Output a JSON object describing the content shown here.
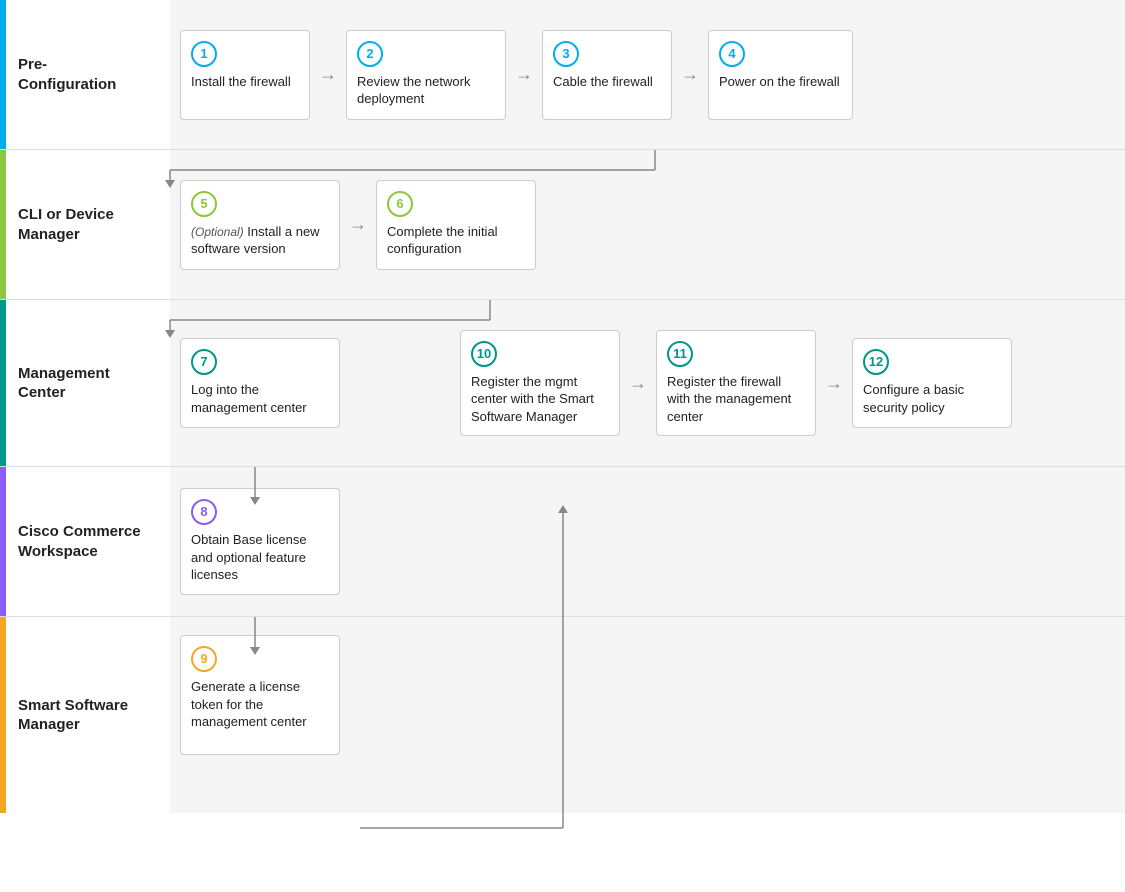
{
  "sections": [
    {
      "id": "pre-config",
      "label": "Pre-\nConfiguration",
      "color": "blue",
      "steps": [
        {
          "num": "1",
          "color": "blue",
          "text": "Install the firewall"
        },
        {
          "num": "2",
          "color": "blue",
          "text": "Review the network deployment"
        },
        {
          "num": "3",
          "color": "blue",
          "text": "Cable the firewall"
        },
        {
          "num": "4",
          "color": "blue",
          "text": "Power on the firewall"
        }
      ]
    },
    {
      "id": "cli",
      "label": "CLI or Device Manager",
      "color": "green",
      "steps": [
        {
          "num": "5",
          "color": "green",
          "text": "Install a new software version",
          "optional": true
        },
        {
          "num": "6",
          "color": "green",
          "text": "Complete the initial configuration"
        }
      ]
    },
    {
      "id": "mgmt",
      "label": "Management Center",
      "color": "teal",
      "steps": [
        {
          "num": "7",
          "color": "teal",
          "text": "Log into the management center"
        },
        {
          "num": "10",
          "color": "teal",
          "text": "Register the mgmt center with the Smart Software Manager"
        },
        {
          "num": "11",
          "color": "teal",
          "text": "Register the firewall with the management center"
        },
        {
          "num": "12",
          "color": "teal",
          "text": "Configure a basic security policy"
        }
      ]
    },
    {
      "id": "cisco",
      "label": "Cisco Commerce Workspace",
      "color": "purple",
      "steps": [
        {
          "num": "8",
          "color": "purple",
          "text": "Obtain Base license and optional feature licenses"
        }
      ]
    },
    {
      "id": "smart",
      "label": "Smart Software Manager",
      "color": "orange",
      "steps": [
        {
          "num": "9",
          "color": "orange",
          "text": "Generate a license token for the management center"
        }
      ]
    }
  ],
  "arrows": {
    "right": "→",
    "down": "↓"
  }
}
